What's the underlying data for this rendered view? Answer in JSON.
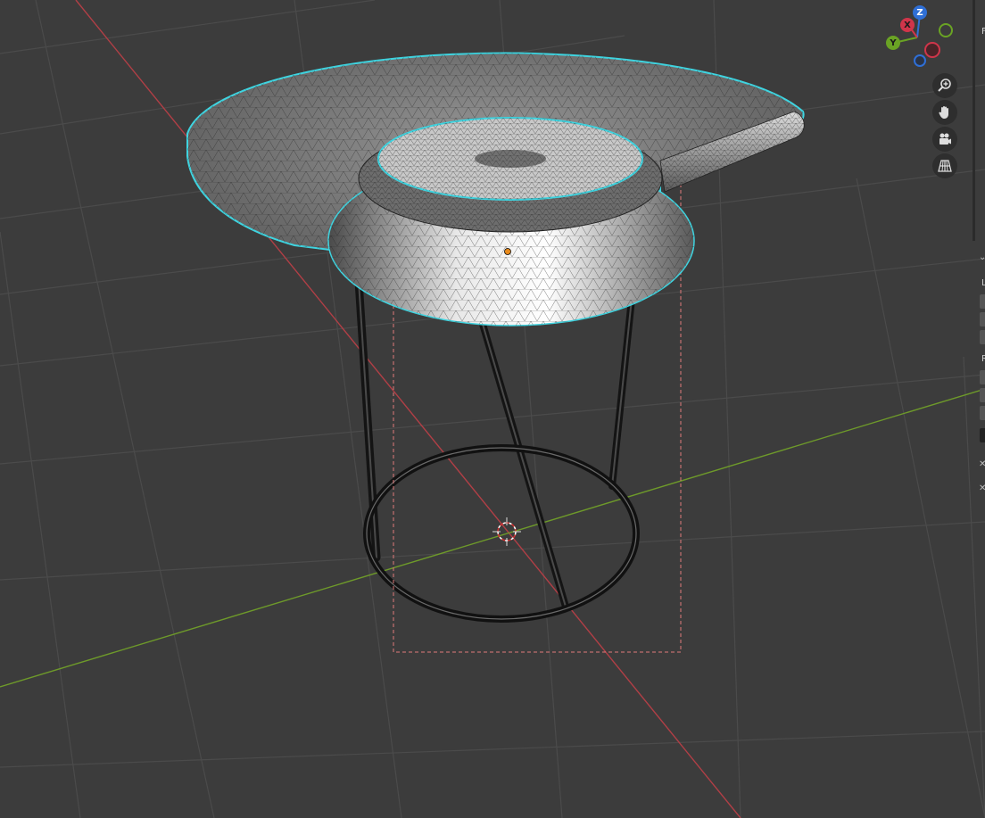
{
  "gizmo": {
    "z_label": "Z",
    "x_label": "X",
    "y_label": "Y",
    "z_color": "#2f6fd6",
    "x_color": "#d0354a",
    "y_color": "#6aa324"
  },
  "nav_buttons": [
    {
      "icon": "zoom-in-icon"
    },
    {
      "icon": "hand-pan-icon"
    },
    {
      "icon": "camera-icon"
    },
    {
      "icon": "grid-perspective-icon"
    }
  ],
  "right_panel": {
    "labels": [
      "F",
      "L",
      "R"
    ]
  },
  "colors": {
    "viewport_bg": "#3c3c3c",
    "grid_line": "#4a4a4a",
    "x_axis": "#b13f46",
    "y_axis": "#6e9a2a",
    "selection_outline": "#3fd4e0",
    "bounds_box": "#e07a7a",
    "origin_dot": "#e88a1c"
  }
}
